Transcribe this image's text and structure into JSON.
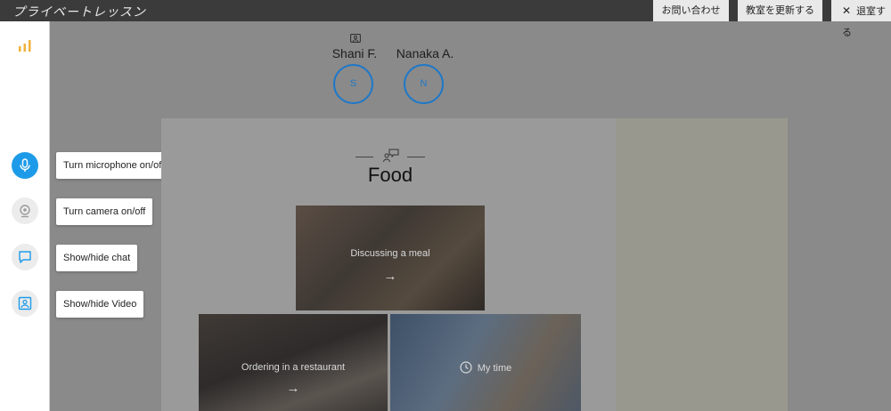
{
  "app": {
    "title": "プライベートレッスン"
  },
  "topbar": {
    "contact_label": "お問い合わせ",
    "refresh_label": "教室を更新する",
    "leave_icon": "✕",
    "leave_label": "退室する"
  },
  "sidebar": {
    "stats_icon": "bar-chart-icon",
    "accent_color": "#1e9be8",
    "tooltips": {
      "mic": "Turn microphone on/off",
      "camera": "Turn camera on/off",
      "chat": "Show/hide chat",
      "video": "Show/hide Video"
    }
  },
  "participants": [
    {
      "name": "Shani F.",
      "initial": "S",
      "presenter": true
    },
    {
      "name": "Nanaka A.",
      "initial": "N",
      "presenter": false
    }
  ],
  "lesson": {
    "title": "Food",
    "cards": [
      {
        "label": "Discussing a meal",
        "arrow": "→"
      },
      {
        "label": "Ordering in a restaurant",
        "arrow": "→"
      },
      {
        "label": "My time",
        "icon": "clock-icon"
      }
    ]
  }
}
